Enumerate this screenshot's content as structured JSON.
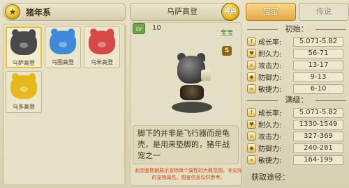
{
  "series": {
    "title": "猪年系",
    "icon_glyph": "★"
  },
  "pets": [
    {
      "name": "乌萨高登",
      "color": "#4a4a4a"
    },
    {
      "name": "乌图高登",
      "color": "#3d8ad8"
    },
    {
      "name": "乌米高登",
      "color": "#d84848"
    },
    {
      "name": "乌多高登",
      "color": "#e5b81c"
    }
  ],
  "detail": {
    "name": "乌萨高登",
    "transform_label": "神启",
    "level_badge": "LV",
    "level": "10",
    "type_tag": "宝宝",
    "grade_badge": "S",
    "description": "脚下的并非是飞行器而是龟壳，是用来垫脚的，猪年战宠之一",
    "note": "此图鉴数据展示宠物单个属性的大概范围，非实际的宠物属性，图鉴信息仅供参考。"
  },
  "tabs": {
    "active": "宝宝",
    "inactive": "传说"
  },
  "initial": {
    "title": "初始：",
    "stats": [
      {
        "label": "成长率:",
        "value": "5.071-5.82",
        "icon": "↑"
      },
      {
        "label": "耐久力:",
        "value": "56-71",
        "icon": "♥"
      },
      {
        "label": "攻击力:",
        "value": "13-17",
        "icon": "⚔"
      },
      {
        "label": "防御力:",
        "value": "9-13",
        "icon": "◆"
      },
      {
        "label": "敏捷力:",
        "value": "6-10",
        "icon": "»"
      }
    ]
  },
  "max": {
    "title": "满级：",
    "stats": [
      {
        "label": "成长率:",
        "value": "5.071-5.82",
        "icon": "↑"
      },
      {
        "label": "耐久力:",
        "value": "1330-1549",
        "icon": "♥"
      },
      {
        "label": "攻击力:",
        "value": "327-369",
        "icon": "⚔"
      },
      {
        "label": "防御力:",
        "value": "240-281",
        "icon": "◆"
      },
      {
        "label": "敏捷力:",
        "value": "164-199",
        "icon": "»"
      }
    ]
  },
  "acquire_label": "获取途径："
}
